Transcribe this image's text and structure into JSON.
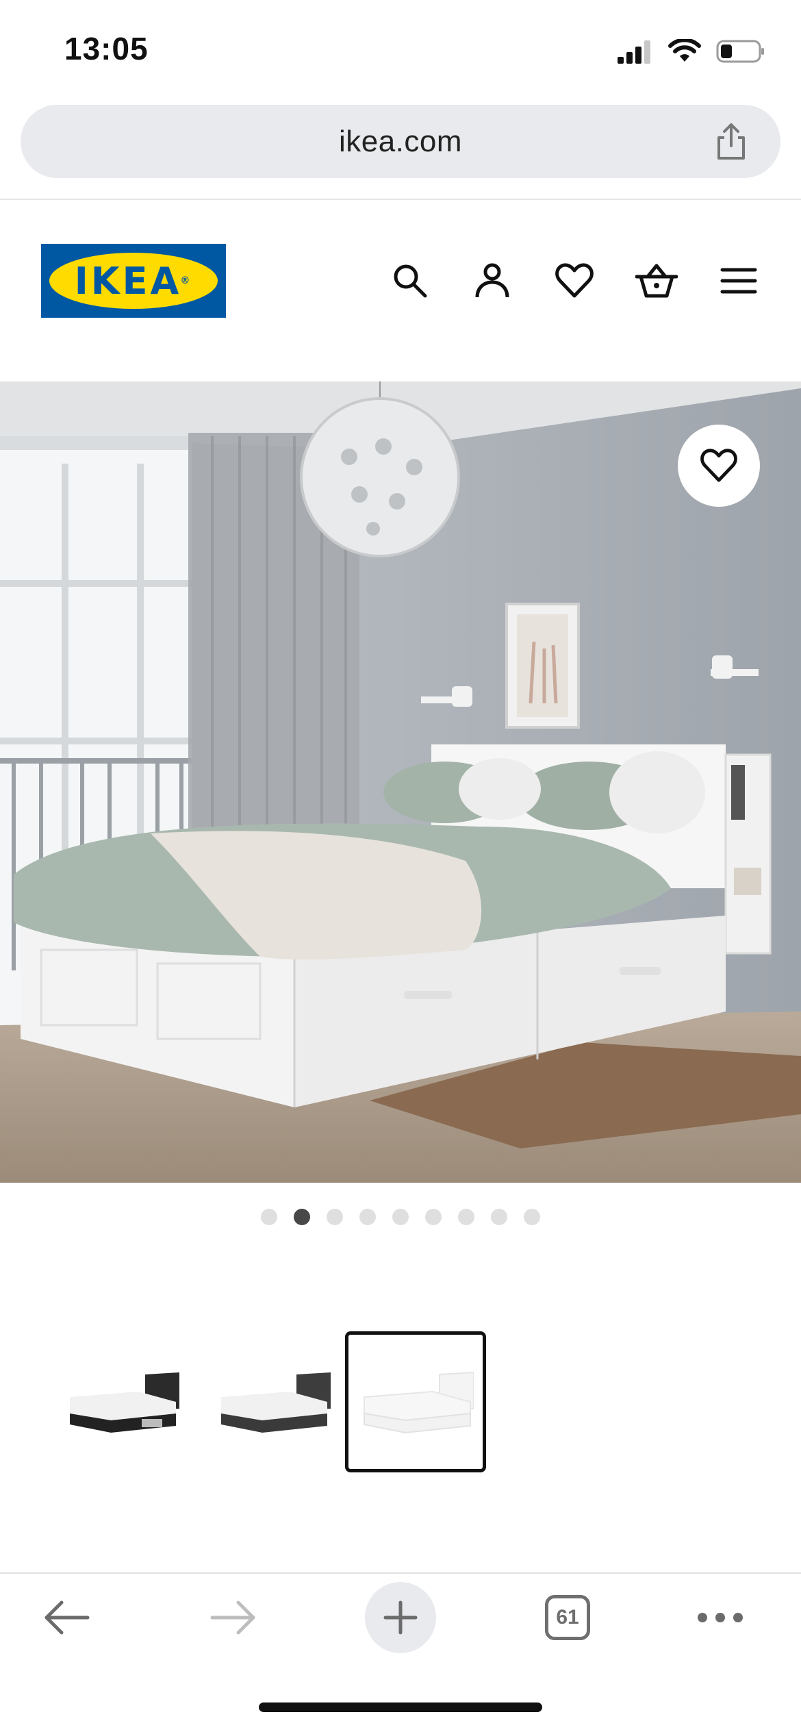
{
  "status_bar": {
    "time": "13:05",
    "battery_level": 0.3
  },
  "browser": {
    "url": "ikea.com",
    "tab_count": "61"
  },
  "brand": {
    "logo_text": "IKEA",
    "logo_mark": "®",
    "blue": "#0058a3",
    "yellow": "#ffdb00"
  },
  "header_icons": [
    "search-icon",
    "account-icon",
    "heart-icon",
    "basket-icon",
    "menu-icon"
  ],
  "carousel": {
    "total_slides": 9,
    "active_slide": 2
  },
  "thumbnails": [
    {
      "variant": "black-brown",
      "selected": false
    },
    {
      "variant": "dark-grey",
      "selected": false
    },
    {
      "variant": "white",
      "selected": true
    }
  ],
  "bottom_bar_icons": [
    "back-arrow-icon",
    "forward-arrow-icon",
    "new-tab-plus-icon",
    "tabs-icon",
    "more-dots-icon"
  ]
}
